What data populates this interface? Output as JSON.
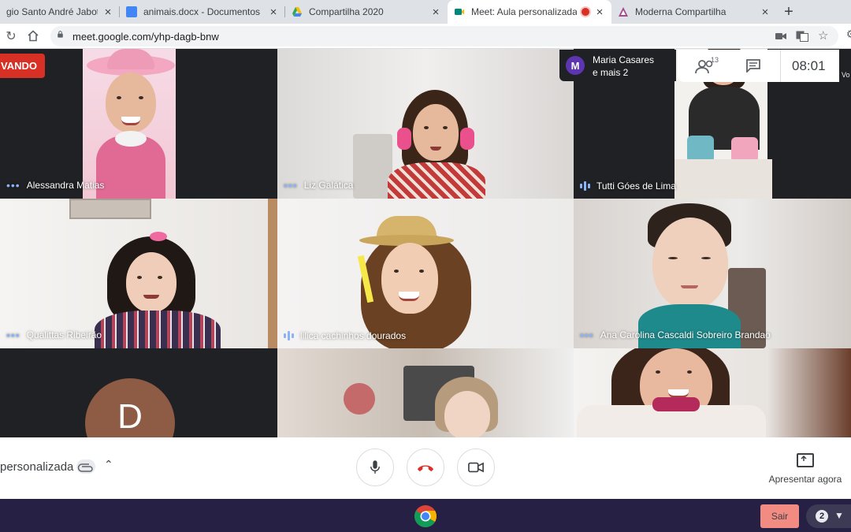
{
  "browser": {
    "tabs": [
      {
        "title": "gio Santo André Jaboticab",
        "favicon": "school-favicon",
        "close": "×"
      },
      {
        "title": "animais.docx - Documentos Go",
        "favicon": "google-docs-icon",
        "close": "×"
      },
      {
        "title": "Compartilha 2020",
        "favicon": "drive-icon",
        "close": "×"
      },
      {
        "title": "Meet: Aula personalizada",
        "favicon": "meet-icon",
        "close": "×",
        "active": true,
        "recording": true
      },
      {
        "title": "Moderna Compartilha",
        "favicon": "moderna-icon",
        "close": "×"
      }
    ],
    "new_tab": "+",
    "url": "meet.google.com/yhp-dagb-bnw"
  },
  "meet": {
    "recording_label": "VANDO",
    "presenter": {
      "initial": "M",
      "line1": "Maria Casares",
      "line2": "e mais 2"
    },
    "participants_count": "13",
    "clock": "08:01",
    "edge_label": "Vo",
    "tiles": [
      {
        "name": "Alessandra Matias",
        "indicator": "dots"
      },
      {
        "name": "Liz Galática",
        "indicator": "dots"
      },
      {
        "name": "Tutti Góes de Lima",
        "indicator": "bars"
      },
      {
        "name": "Qualittas Ribeirão",
        "indicator": "dots"
      },
      {
        "name": "lilica cachinhos dourados",
        "indicator": "bars"
      },
      {
        "name": "Ana Carolina Cascaldi Sobreiro Brandao",
        "indicator": "dots"
      }
    ],
    "avatar_letter": "D",
    "meeting_title": "personalizada",
    "present_now": "Apresentar agora"
  },
  "os": {
    "sair": "Sair",
    "notifications": "2"
  },
  "colors": {
    "grid_bg": "#202124",
    "record_red": "#d93025",
    "hangup_red": "#d93025",
    "talk_indicator": "#8ab4f8",
    "taskbar": "#262044",
    "sair_button": "#f28b82"
  }
}
